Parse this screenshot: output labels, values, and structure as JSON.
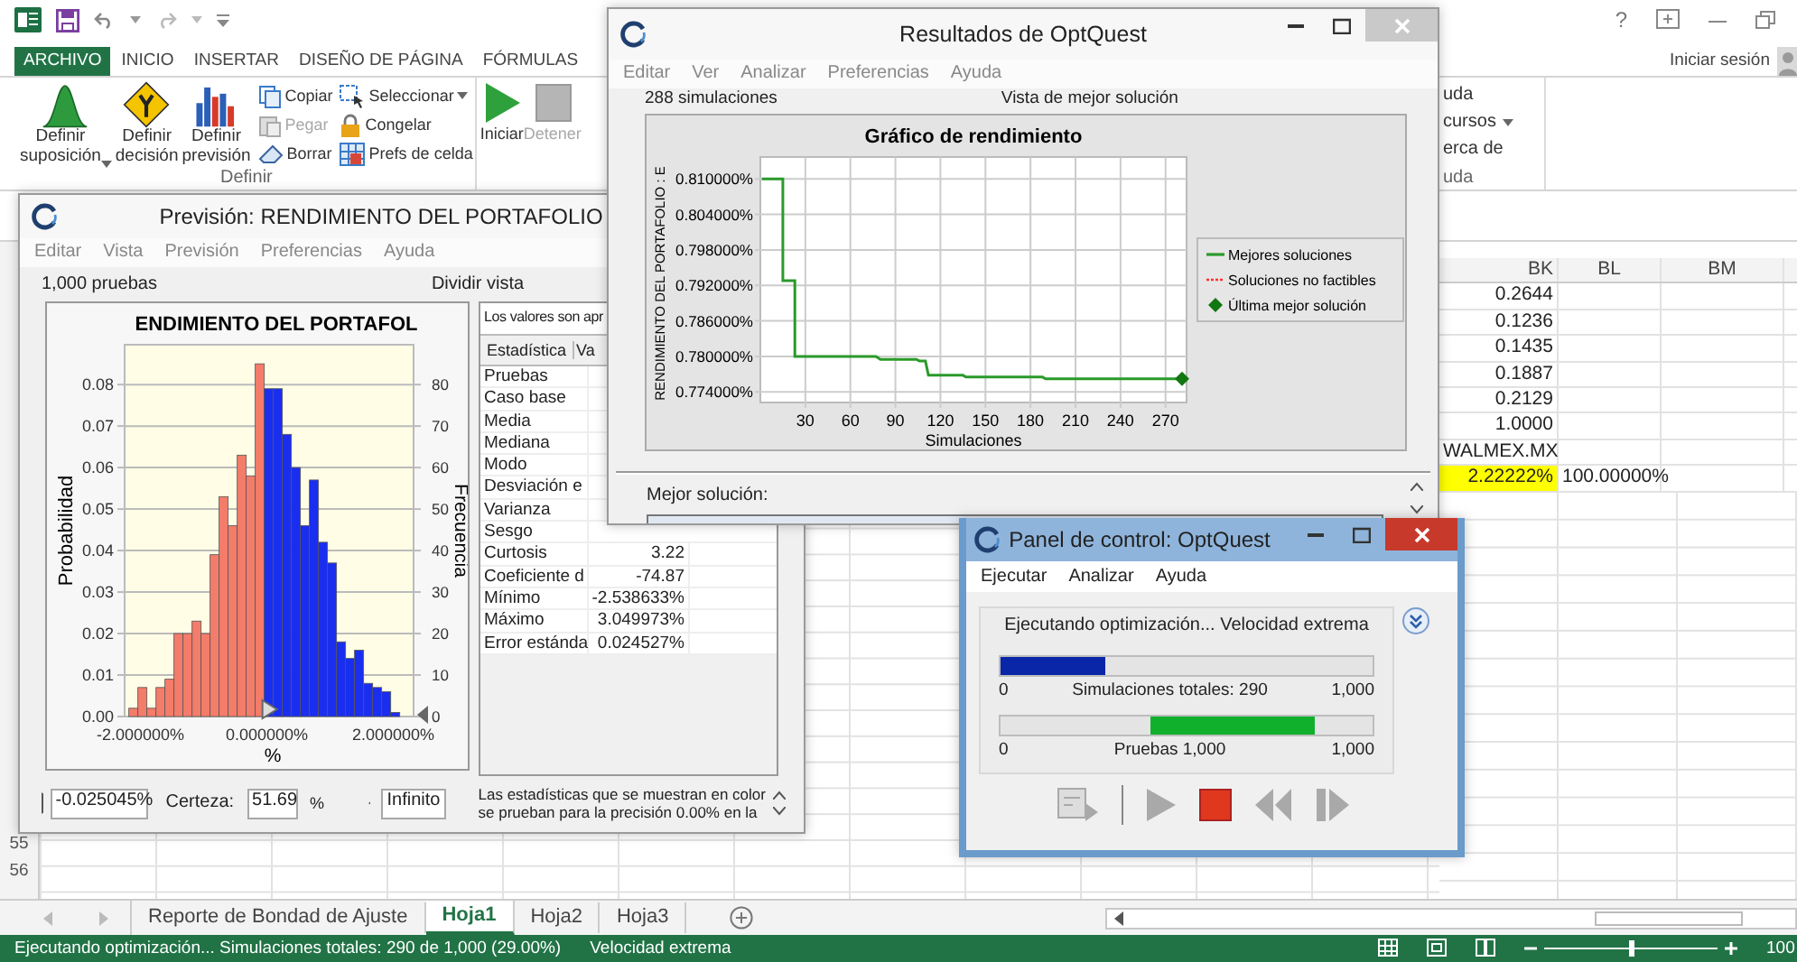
{
  "excel": {
    "help": "?",
    "tabs": [
      {
        "label": "ARCHIVO",
        "kind": "file"
      },
      {
        "label": "INICIO",
        "kind": "tab"
      },
      {
        "label": "INSERTAR",
        "kind": "tab"
      },
      {
        "label": "DISEÑO DE PÁGINA",
        "kind": "tab"
      },
      {
        "label": "FÓRMULAS",
        "kind": "tab"
      }
    ],
    "sign_in": "Iniciar sesión",
    "define_group": {
      "label": "Definir",
      "large_buttons": [
        {
          "label": "Definir suposición",
          "dropdown": true
        },
        {
          "label": "Definir decisión",
          "dropdown": false
        },
        {
          "label": "Definir previsión",
          "dropdown": false
        }
      ],
      "small_columns": [
        [
          {
            "label": "Copiar",
            "disabled": false,
            "dropdown": false
          },
          {
            "label": "Pegar",
            "disabled": true,
            "dropdown": false
          },
          {
            "label": "Borrar",
            "disabled": false,
            "dropdown": false
          }
        ],
        [
          {
            "label": "Seleccionar",
            "disabled": false,
            "dropdown": true
          },
          {
            "label": "Congelar",
            "disabled": false,
            "dropdown": false
          },
          {
            "label": "Prefs de celda",
            "disabled": false,
            "dropdown": false
          }
        ]
      ]
    },
    "run_buttons": [
      {
        "label": "Iniciar",
        "disabled": false
      },
      {
        "label": "Detener",
        "disabled": true
      }
    ],
    "help_group": {
      "items": [
        {
          "label": "uda",
          "dropdown": false
        },
        {
          "label": "cursos",
          "dropdown": true
        },
        {
          "label": "erca de",
          "dropdown": false
        }
      ],
      "label": "uda"
    },
    "sheet": {
      "columns": [
        "BK",
        "BL",
        "BM"
      ],
      "rows": [
        {
          "cells": [
            "0.2644"
          ],
          "highlight": false
        },
        {
          "cells": [
            "0.1236"
          ],
          "highlight": false
        },
        {
          "cells": [
            "0.1435"
          ],
          "highlight": false
        },
        {
          "cells": [
            "0.1887"
          ],
          "highlight": false
        },
        {
          "cells": [
            "0.2129"
          ],
          "highlight": false
        },
        {
          "cells": [
            "1.0000"
          ],
          "highlight": false
        },
        {
          "cells": [
            "WALMEX.MX"
          ],
          "highlight": false
        },
        {
          "cells": [
            "2.22222%",
            "100.00000%"
          ],
          "highlight": true
        }
      ],
      "row_numbers": [
        "55",
        "56"
      ]
    },
    "sheet_tabs": [
      {
        "label": "Reporte de Bondad de Ajuste",
        "selected": false
      },
      {
        "label": "Hoja1",
        "selected": true
      },
      {
        "label": "Hoja2",
        "selected": false
      },
      {
        "label": "Hoja3",
        "selected": false
      }
    ],
    "status_bar": {
      "message": "Ejecutando optimización... Simulaciones totales: 290 de 1,000 (29.00%)",
      "mode": "Velocidad extrema",
      "zoom_slider": {
        "level": 0.5
      },
      "zoom": "100"
    }
  },
  "forecast_window": {
    "title": "Previsión: RENDIMIENTO DEL PORTAFOLIO",
    "menu": [
      "Editar",
      "Vista",
      "Previsión",
      "Preferencias",
      "Ayuda"
    ],
    "trials": "1,000 pruebas",
    "split_view": "Dividir vista",
    "chart_data": {
      "type": "bar",
      "title": "ENDIMIENTO DEL PORTAFOL",
      "xlabel": "%",
      "ylabel": "Frecuencia",
      "y2label": "Probabilidad",
      "x": [
        -2.112,
        -1.969,
        -1.826,
        -1.683,
        -1.541,
        -1.398,
        -1.255,
        -1.112,
        -0.97,
        -0.827,
        -0.684,
        -0.541,
        -0.398,
        -0.256,
        -0.113,
        0.03,
        0.173,
        0.316,
        0.459,
        0.601,
        0.744,
        0.887,
        1.03,
        1.173,
        1.315,
        1.458,
        1.601,
        1.744,
        1.887,
        2.03
      ],
      "series": [
        {
          "color": "#f47c6a",
          "values": [
            2,
            7,
            2,
            7,
            9,
            20,
            20,
            23,
            20,
            39,
            53,
            46,
            63,
            58,
            85,
            null,
            null,
            null,
            null,
            null,
            null,
            null,
            null,
            null,
            null,
            null,
            null,
            null,
            null,
            null
          ]
        },
        {
          "color": "#1a2ef0",
          "values": [
            null,
            null,
            null,
            null,
            null,
            null,
            null,
            null,
            null,
            null,
            null,
            null,
            null,
            null,
            null,
            79,
            79,
            68,
            60,
            46,
            57,
            42,
            37,
            18,
            14,
            16,
            8,
            7,
            6,
            1
          ]
        }
      ],
      "grid": true,
      "xlim": [
        -2.25,
        2.32
      ],
      "ylim": [
        0,
        89.6
      ],
      "xticks": [
        {
          "value": -2,
          "label": "-2.000000%"
        },
        {
          "value": 0,
          "label": "0.000000%"
        },
        {
          "value": 2,
          "label": "2.000000%"
        }
      ],
      "yticks": [
        0,
        10,
        20,
        30,
        40,
        50,
        60,
        70,
        80
      ],
      "y2lim": [
        0,
        0.0896
      ],
      "y2ticks": [
        {
          "value": 0,
          "label": "0.00"
        },
        {
          "value": 0.01,
          "label": "0.01"
        },
        {
          "value": 0.02,
          "label": "0.02"
        },
        {
          "value": 0.03,
          "label": "0.03"
        },
        {
          "value": 0.04,
          "label": "0.04"
        },
        {
          "value": 0.05,
          "label": "0.05"
        },
        {
          "value": 0.06,
          "label": "0.06"
        },
        {
          "value": 0.07,
          "label": "0.07"
        },
        {
          "value": 0.08,
          "label": "0.08"
        }
      ]
    },
    "stats": {
      "note": "Los valores son apr",
      "columns": [
        "Estadística",
        "Va"
      ],
      "rows": [
        {
          "name": "Pruebas"
        },
        {
          "name": "Caso base"
        },
        {
          "name": "Media"
        },
        {
          "name": "Mediana"
        },
        {
          "name": "Modo"
        },
        {
          "name": "Desviación e"
        },
        {
          "name": "Varianza"
        },
        {
          "name": "Sesgo"
        },
        {
          "name": "Curtosis",
          "value": "3.22"
        },
        {
          "name": "Coeficiente d",
          "value": "-74.87"
        },
        {
          "name": "Mínimo",
          "value": "-2.538633%"
        },
        {
          "name": "Máximo",
          "value": "3.049973%"
        },
        {
          "name": "Error estánda",
          "value": "0.024527%"
        }
      ]
    },
    "lower_bound": "-0.025045%",
    "certainty_label": "Certeza:",
    "certainty": "51.69",
    "percent": "%",
    "upper_bound": "Infinito",
    "footnote": "Las estadísticas que se muestran en color\nse prueban para la precisión 0.00% en la"
  },
  "optquest_window": {
    "title": "Resultados de OptQuest",
    "active": false,
    "menu": [
      "Editar",
      "Ver",
      "Analizar",
      "Preferencias",
      "Ayuda"
    ],
    "simulations": "288 simulaciones",
    "view": "Vista de mejor solución",
    "chart_data": {
      "type": "line",
      "title": "Gráfico de rendimiento",
      "xlabel": "Simulaciones",
      "ylabel": "RENDIMIENTO DEL PORTAFOLIO : E",
      "x": [
        1,
        15,
        15,
        23,
        23,
        77,
        80,
        104,
        106,
        110,
        112,
        135,
        137,
        188,
        190,
        281
      ],
      "series": [
        {
          "name": "Mejores soluciones",
          "color": "#2a9a2a",
          "values": [
            0.81,
            0.81,
            0.7928,
            0.7928,
            0.78,
            0.78,
            0.7795,
            0.7795,
            0.7792,
            0.7792,
            0.7768,
            0.7768,
            0.7765,
            0.7765,
            0.7762,
            0.7762
          ]
        }
      ],
      "grid": true,
      "xlim": [
        0,
        284
      ],
      "ylim": [
        0.7722,
        0.8137
      ],
      "xticks": [
        30,
        60,
        90,
        120,
        150,
        180,
        210,
        240,
        270
      ],
      "yticks": [
        {
          "value": 0.774,
          "label": "0.774000%"
        },
        {
          "value": 0.78,
          "label": "0.780000%"
        },
        {
          "value": 0.786,
          "label": "0.786000%"
        },
        {
          "value": 0.792,
          "label": "0.792000%"
        },
        {
          "value": 0.798,
          "label": "0.798000%"
        },
        {
          "value": 0.804,
          "label": "0.804000%"
        },
        {
          "value": 0.81,
          "label": "0.810000%"
        }
      ]
    },
    "legend": [
      {
        "label": "Soluciones no factibles",
        "kind": "dotted",
        "color": "#ff3030"
      },
      {
        "label": "Última mejor solución",
        "kind": "diamond",
        "color": "#117711"
      }
    ],
    "best_label": "Mejor solución:"
  },
  "control_panel": {
    "title": "Panel de control: OptQuest",
    "active": true,
    "menu": [
      "Ejecutar",
      "Analizar",
      "Ayuda"
    ],
    "status": "Ejecutando optimización... Velocidad extrema",
    "bars": [
      {
        "kind": "fill",
        "level": 0.28,
        "color": "#0a26a8",
        "min": "0",
        "caption": "Simulaciones totales: 290",
        "max": "1,000"
      },
      {
        "kind": "marquee",
        "color": "#10b02c",
        "min": "0",
        "caption": "Pruebas 1,000",
        "max": "1,000"
      }
    ],
    "tools": [
      {
        "kind": "report",
        "disabled": true
      },
      {
        "kind": "separator"
      },
      {
        "kind": "play",
        "disabled": true
      },
      {
        "kind": "stop",
        "disabled": false
      },
      {
        "kind": "rewind",
        "disabled": true
      },
      {
        "kind": "step",
        "disabled": true
      }
    ]
  }
}
